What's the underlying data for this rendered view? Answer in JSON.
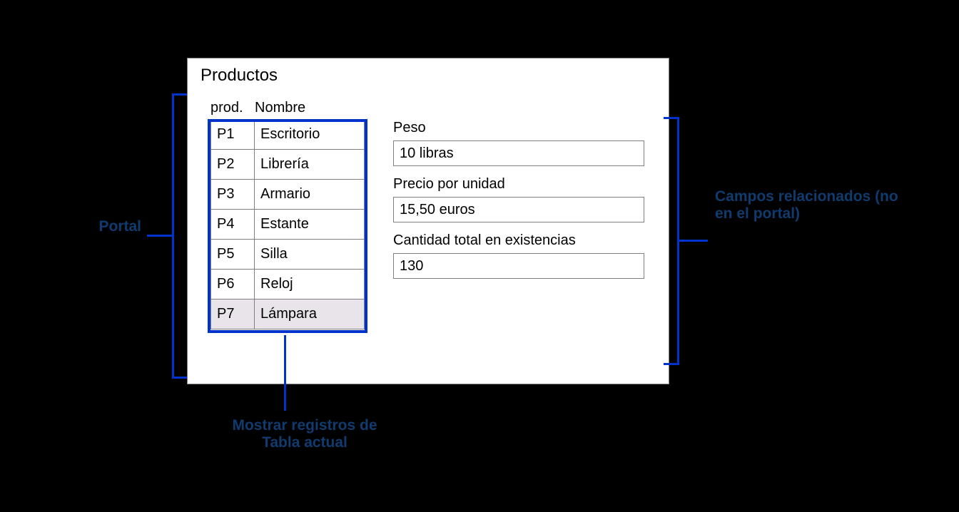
{
  "panel": {
    "title": "Productos"
  },
  "table": {
    "headers": {
      "prod": "prod.",
      "name": "Nombre"
    },
    "rows": [
      {
        "prod": "P1",
        "name": "Escritorio"
      },
      {
        "prod": "P2",
        "name": "Librería"
      },
      {
        "prod": "P3",
        "name": "Armario"
      },
      {
        "prod": "P4",
        "name": "Estante"
      },
      {
        "prod": "P5",
        "name": "Silla"
      },
      {
        "prod": "P6",
        "name": "Reloj"
      },
      {
        "prod": "P7",
        "name": "Lámpara"
      }
    ],
    "selected_index": 6
  },
  "detail": {
    "weight": {
      "label": "Peso",
      "value": "10 libras"
    },
    "price": {
      "label": "Precio por unidad",
      "value": "15,50 euros"
    },
    "stock": {
      "label": "Cantidad total en existencias",
      "value": "130"
    }
  },
  "annotations": {
    "left": "Portal",
    "right": "Campos relacionados (no en el portal)",
    "bottom": "Mostrar registros de Tabla actual"
  }
}
